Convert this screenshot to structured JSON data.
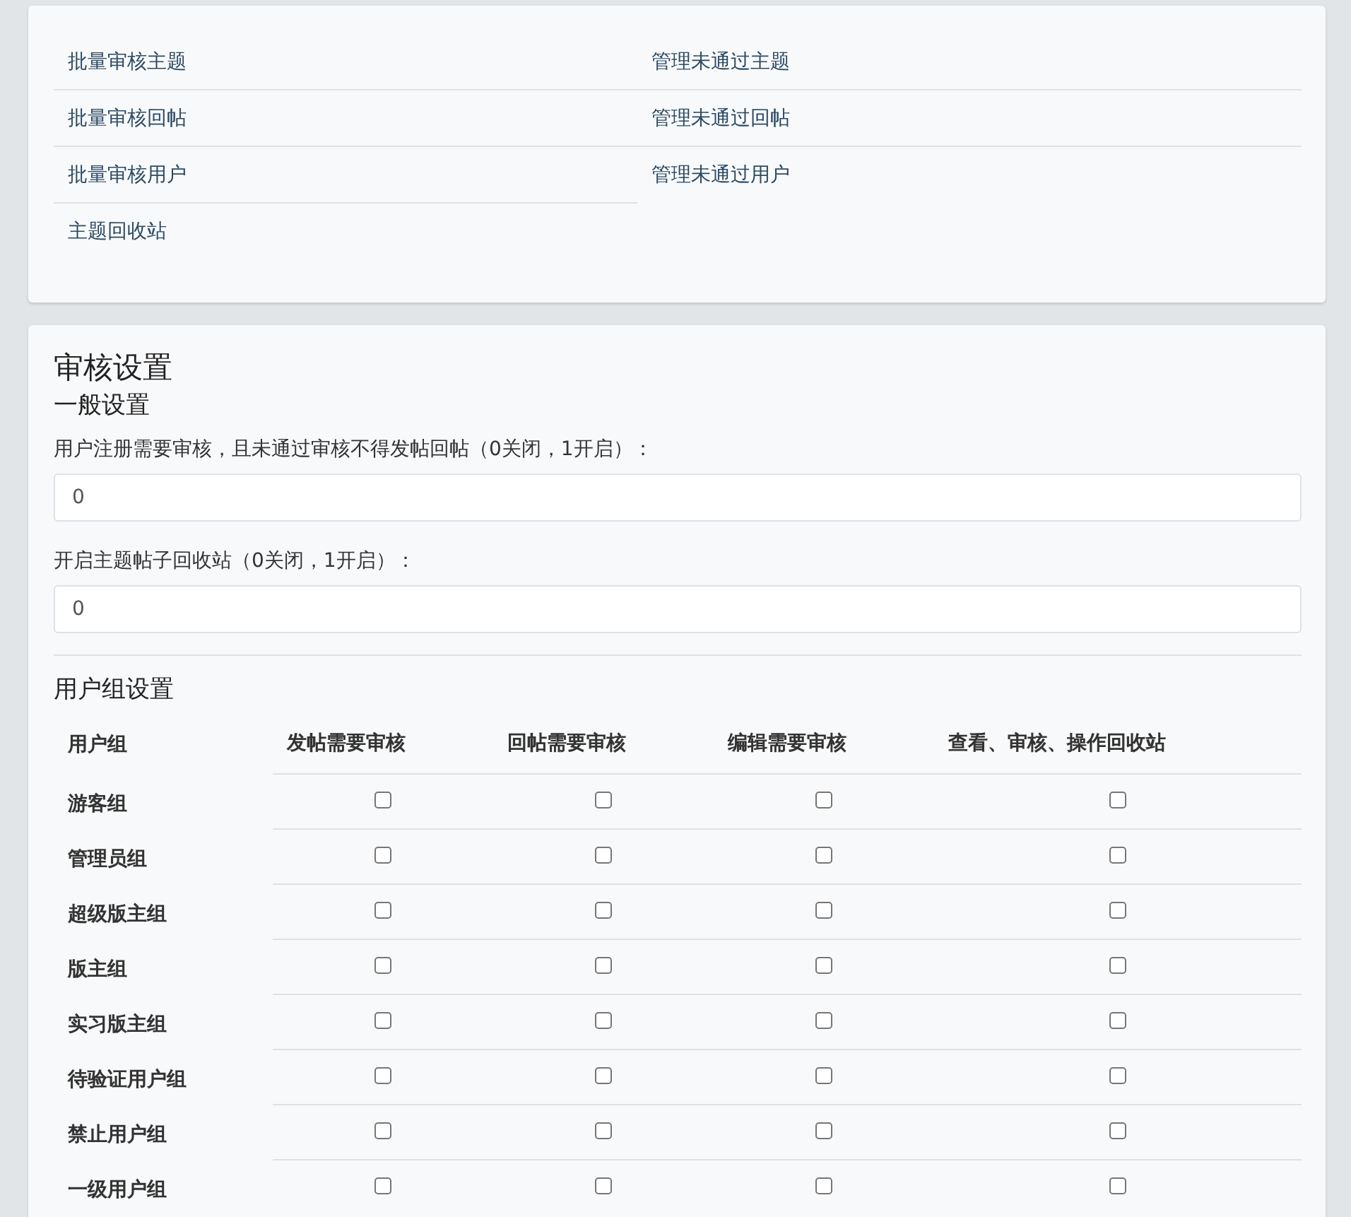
{
  "links": [
    {
      "label": "批量审核主题"
    },
    {
      "label": "管理未通过主题"
    },
    {
      "label": "批量审核回帖"
    },
    {
      "label": "管理未通过回帖"
    },
    {
      "label": "批量审核用户"
    },
    {
      "label": "管理未通过用户"
    },
    {
      "label": "主题回收站"
    }
  ],
  "settings": {
    "title": "审核设置",
    "general_title": "一般设置",
    "fields": [
      {
        "label": "用户注册需要审核，且未通过审核不得发帖回帖（0关闭，1开启）：",
        "value": "0"
      },
      {
        "label": "开启主题帖子回收站（0关闭，1开启）：",
        "value": "0"
      }
    ],
    "group_title": "用户组设置",
    "table": {
      "columns": [
        "用户组",
        "发帖需要审核",
        "回帖需要审核",
        "编辑需要审核",
        "查看、审核、操作回收站"
      ],
      "rows": [
        {
          "group": "游客组",
          "checks": [
            {
              "checked": false
            },
            {
              "checked": false
            },
            {
              "checked": false
            },
            {
              "checked": false
            }
          ]
        },
        {
          "group": "管理员组",
          "checks": [
            {
              "checked": false
            },
            {
              "checked": false
            },
            {
              "checked": false
            },
            {
              "checked": false
            }
          ]
        },
        {
          "group": "超级版主组",
          "checks": [
            {
              "checked": false
            },
            {
              "checked": false
            },
            {
              "checked": false
            },
            {
              "checked": false
            }
          ]
        },
        {
          "group": "版主组",
          "checks": [
            {
              "checked": false
            },
            {
              "checked": false
            },
            {
              "checked": false
            },
            {
              "checked": false
            }
          ]
        },
        {
          "group": "实习版主组",
          "checks": [
            {
              "checked": false
            },
            {
              "checked": false
            },
            {
              "checked": false
            },
            {
              "checked": false
            }
          ]
        },
        {
          "group": "待验证用户组",
          "checks": [
            {
              "checked": false
            },
            {
              "checked": false
            },
            {
              "checked": false
            },
            {
              "checked": false
            }
          ]
        },
        {
          "group": "禁止用户组",
          "checks": [
            {
              "checked": false
            },
            {
              "checked": false
            },
            {
              "checked": false
            },
            {
              "checked": false
            }
          ]
        },
        {
          "group": "一级用户组",
          "checks": [
            {
              "checked": false
            },
            {
              "checked": false
            },
            {
              "checked": false
            },
            {
              "checked": false
            }
          ]
        }
      ]
    }
  }
}
